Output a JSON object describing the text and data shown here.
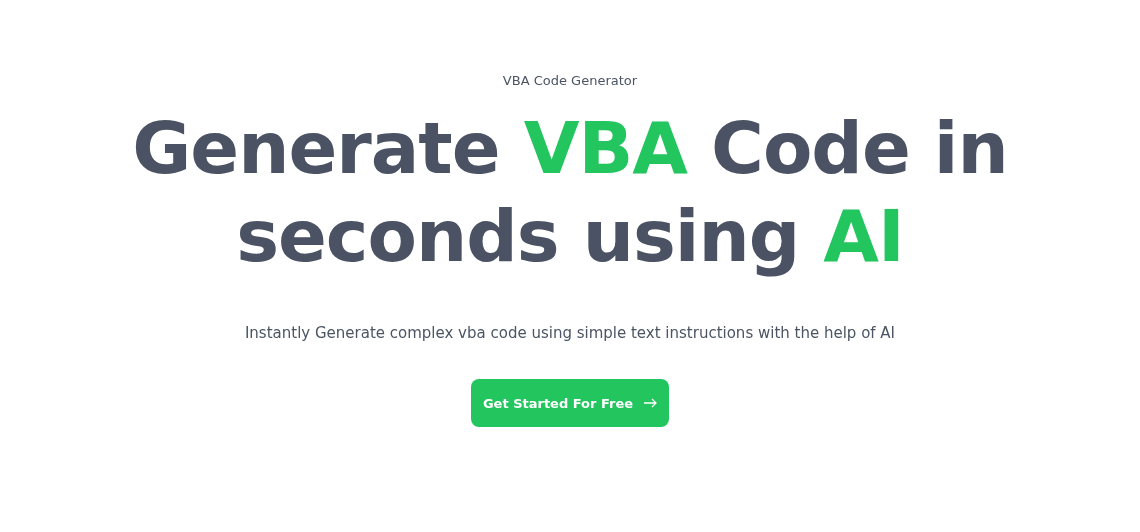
{
  "eyebrow": "VBA Code Generator",
  "headline": [
    {
      "text": "Generate ",
      "highlight": false
    },
    {
      "text": "VBA",
      "highlight": true
    },
    {
      "text": " Code in seconds using ",
      "highlight": false
    },
    {
      "text": "AI",
      "highlight": true
    }
  ],
  "subtitle": "Instantly Generate complex vba code using simple text instructions with the help of AI",
  "cta": {
    "label": "Get Started For Free"
  }
}
